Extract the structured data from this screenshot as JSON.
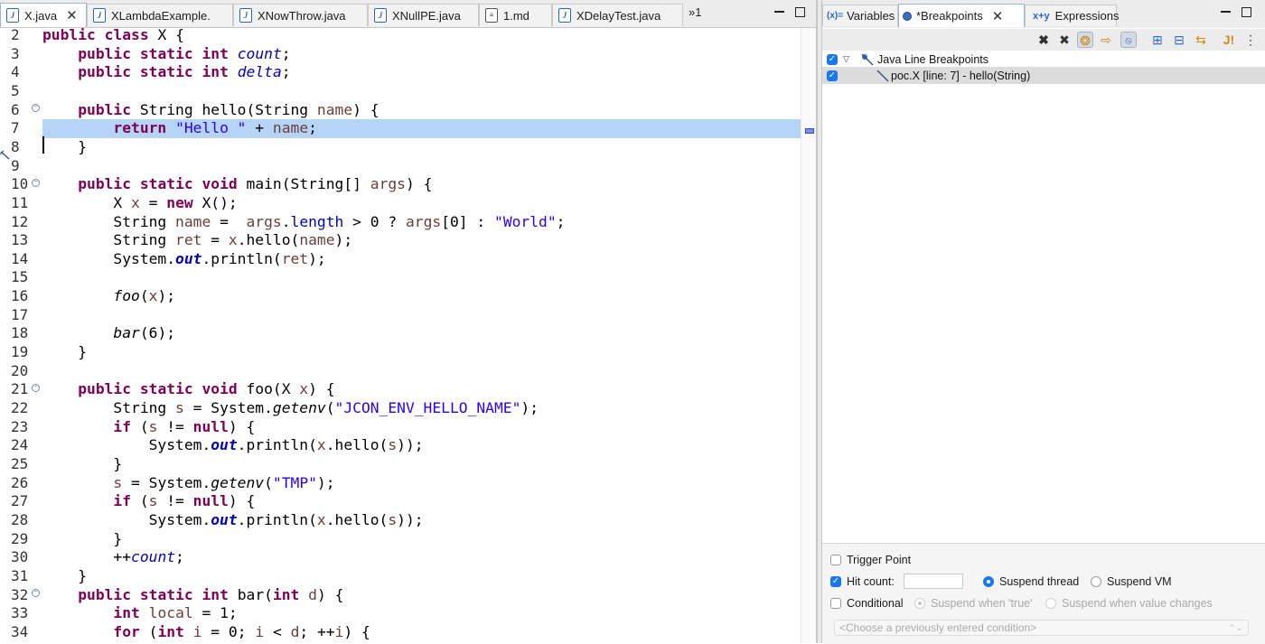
{
  "editor": {
    "tabs": [
      {
        "label": "X.java",
        "icon": "java-file-icon",
        "active": true,
        "closable": true
      },
      {
        "label": "XLambdaExample.",
        "icon": "java-file-icon"
      },
      {
        "label": "XNowThrow.java",
        "icon": "java-file-icon"
      },
      {
        "label": "XNullPE.java",
        "icon": "java-file-icon"
      },
      {
        "label": "1.md",
        "icon": "markdown-file-icon"
      },
      {
        "label": "XDelayTest.java",
        "icon": "java-file-icon"
      }
    ],
    "overflow_label": "»1",
    "line_numbers": [
      "2",
      "3",
      "4",
      "5",
      "6",
      "7",
      "8",
      "9",
      "10",
      "11",
      "12",
      "13",
      "14",
      "15",
      "16",
      "17",
      "18",
      "19",
      "20",
      "21",
      "22",
      "23",
      "24",
      "25",
      "26",
      "27",
      "28",
      "29",
      "30",
      "31",
      "32",
      "33",
      "34"
    ],
    "highlighted_line": "7",
    "code_lines": [
      [
        [
          "kw",
          "public"
        ],
        [
          "t",
          " "
        ],
        [
          "kw",
          "class"
        ],
        [
          "t",
          " X {"
        ]
      ],
      [
        [
          "t",
          "    "
        ],
        [
          "kw",
          "public"
        ],
        [
          "t",
          " "
        ],
        [
          "kw",
          "static"
        ],
        [
          "t",
          " "
        ],
        [
          "kw",
          "int"
        ],
        [
          "t",
          " "
        ],
        [
          "fld",
          "count"
        ],
        [
          "t",
          ";"
        ]
      ],
      [
        [
          "t",
          "    "
        ],
        [
          "kw",
          "public"
        ],
        [
          "t",
          " "
        ],
        [
          "kw",
          "static"
        ],
        [
          "t",
          " "
        ],
        [
          "kw",
          "int"
        ],
        [
          "t",
          " "
        ],
        [
          "fld",
          "delta"
        ],
        [
          "t",
          ";"
        ]
      ],
      [
        [
          "t",
          ""
        ]
      ],
      [
        [
          "t",
          "    "
        ],
        [
          "kw",
          "public"
        ],
        [
          "t",
          " String hello(String "
        ],
        [
          "var",
          "name"
        ],
        [
          "t",
          ") {"
        ]
      ],
      [
        [
          "t",
          "        "
        ],
        [
          "kw",
          "return"
        ],
        [
          "t",
          " "
        ],
        [
          "str",
          "\"Hello \""
        ],
        [
          "t",
          " + "
        ],
        [
          "var",
          "name"
        ],
        [
          "t",
          ";"
        ]
      ],
      [
        [
          "t",
          "    }"
        ]
      ],
      [
        [
          "t",
          ""
        ]
      ],
      [
        [
          "t",
          "    "
        ],
        [
          "kw",
          "public"
        ],
        [
          "t",
          " "
        ],
        [
          "kw",
          "static"
        ],
        [
          "t",
          " "
        ],
        [
          "kw",
          "void"
        ],
        [
          "t",
          " main(String[] "
        ],
        [
          "var",
          "args"
        ],
        [
          "t",
          ") {"
        ]
      ],
      [
        [
          "t",
          "        X "
        ],
        [
          "var",
          "x"
        ],
        [
          "t",
          " = "
        ],
        [
          "kw",
          "new"
        ],
        [
          "t",
          " X();"
        ]
      ],
      [
        [
          "t",
          "        String "
        ],
        [
          "var",
          "name"
        ],
        [
          "t",
          " =  "
        ],
        [
          "var",
          "args"
        ],
        [
          "t",
          "."
        ],
        [
          "mfld",
          "length"
        ],
        [
          "t",
          " > 0 ? "
        ],
        [
          "var",
          "args"
        ],
        [
          "t",
          "[0] : "
        ],
        [
          "str",
          "\"World\""
        ],
        [
          "t",
          ";"
        ]
      ],
      [
        [
          "t",
          "        String "
        ],
        [
          "var",
          "ret"
        ],
        [
          "t",
          " = "
        ],
        [
          "var",
          "x"
        ],
        [
          "t",
          ".hello("
        ],
        [
          "var",
          "name"
        ],
        [
          "t",
          ");"
        ]
      ],
      [
        [
          "t",
          "        System."
        ],
        [
          "sfld",
          "out"
        ],
        [
          "t",
          ".println("
        ],
        [
          "var",
          "ret"
        ],
        [
          "t",
          ");"
        ]
      ],
      [
        [
          "t",
          ""
        ]
      ],
      [
        [
          "t",
          "        "
        ],
        [
          "ital",
          "foo"
        ],
        [
          "t",
          "("
        ],
        [
          "var",
          "x"
        ],
        [
          "t",
          ");"
        ]
      ],
      [
        [
          "t",
          ""
        ]
      ],
      [
        [
          "t",
          "        "
        ],
        [
          "ital",
          "bar"
        ],
        [
          "t",
          "(6);"
        ]
      ],
      [
        [
          "t",
          "    }"
        ]
      ],
      [
        [
          "t",
          ""
        ]
      ],
      [
        [
          "t",
          "    "
        ],
        [
          "kw",
          "public"
        ],
        [
          "t",
          " "
        ],
        [
          "kw",
          "static"
        ],
        [
          "t",
          " "
        ],
        [
          "kw",
          "void"
        ],
        [
          "t",
          " foo(X "
        ],
        [
          "var",
          "x"
        ],
        [
          "t",
          ") {"
        ]
      ],
      [
        [
          "t",
          "        String "
        ],
        [
          "var",
          "s"
        ],
        [
          "t",
          " = System."
        ],
        [
          "ital",
          "getenv"
        ],
        [
          "t",
          "("
        ],
        [
          "str",
          "\"JCON_ENV_HELLO_NAME\""
        ],
        [
          "t",
          ");"
        ]
      ],
      [
        [
          "t",
          "        "
        ],
        [
          "kw",
          "if"
        ],
        [
          "t",
          " ("
        ],
        [
          "var",
          "s"
        ],
        [
          "t",
          " != "
        ],
        [
          "kw",
          "null"
        ],
        [
          "t",
          ") {"
        ]
      ],
      [
        [
          "t",
          "            System."
        ],
        [
          "sfld",
          "out"
        ],
        [
          "t",
          ".println("
        ],
        [
          "var",
          "x"
        ],
        [
          "t",
          ".hello("
        ],
        [
          "var",
          "s"
        ],
        [
          "t",
          "));"
        ]
      ],
      [
        [
          "t",
          "        }"
        ]
      ],
      [
        [
          "t",
          "        "
        ],
        [
          "var",
          "s"
        ],
        [
          "t",
          " = System."
        ],
        [
          "ital",
          "getenv"
        ],
        [
          "t",
          "("
        ],
        [
          "str",
          "\"TMP\""
        ],
        [
          "t",
          ");"
        ]
      ],
      [
        [
          "t",
          "        "
        ],
        [
          "kw",
          "if"
        ],
        [
          "t",
          " ("
        ],
        [
          "var",
          "s"
        ],
        [
          "t",
          " != "
        ],
        [
          "kw",
          "null"
        ],
        [
          "t",
          ") {"
        ]
      ],
      [
        [
          "t",
          "            System."
        ],
        [
          "sfld",
          "out"
        ],
        [
          "t",
          ".println("
        ],
        [
          "var",
          "x"
        ],
        [
          "t",
          ".hello("
        ],
        [
          "var",
          "s"
        ],
        [
          "t",
          "));"
        ]
      ],
      [
        [
          "t",
          "        }"
        ]
      ],
      [
        [
          "t",
          "        ++"
        ],
        [
          "fld",
          "count"
        ],
        [
          "t",
          ";"
        ]
      ],
      [
        [
          "t",
          "    }"
        ]
      ],
      [
        [
          "t",
          "    "
        ],
        [
          "kw",
          "public"
        ],
        [
          "t",
          " "
        ],
        [
          "kw",
          "static"
        ],
        [
          "t",
          " "
        ],
        [
          "kw",
          "int"
        ],
        [
          "t",
          " bar("
        ],
        [
          "kw",
          "int"
        ],
        [
          "t",
          " "
        ],
        [
          "var",
          "d"
        ],
        [
          "t",
          ") {"
        ]
      ],
      [
        [
          "t",
          "        "
        ],
        [
          "kw",
          "int"
        ],
        [
          "t",
          " "
        ],
        [
          "var",
          "local"
        ],
        [
          "t",
          " = 1;"
        ]
      ],
      [
        [
          "t",
          "        "
        ],
        [
          "kw",
          "for"
        ],
        [
          "t",
          " ("
        ],
        [
          "kw",
          "int"
        ],
        [
          "t",
          " "
        ],
        [
          "var",
          "i"
        ],
        [
          "t",
          " = 0; "
        ],
        [
          "var",
          "i"
        ],
        [
          "t",
          " < "
        ],
        [
          "var",
          "d"
        ],
        [
          "t",
          "; ++"
        ],
        [
          "var",
          "i"
        ],
        [
          "t",
          ") {"
        ]
      ]
    ]
  },
  "right_panel": {
    "tabs": [
      {
        "label": "Variables",
        "icon": "variables-icon"
      },
      {
        "label": "*Breakpoints",
        "icon": "breakpoints-icon",
        "active": true,
        "closable": true
      },
      {
        "label": "Expressions",
        "icon": "expressions-icon"
      }
    ],
    "toolbar_icons": [
      "remove-breakpoint-icon",
      "remove-all-breakpoints-icon",
      "show-supported-breakpoints-icon",
      "go-to-file-icon",
      "skip-all-breakpoints-icon",
      "expand-all-icon",
      "collapse-all-icon",
      "link-with-debug-view-icon",
      "add-java-exception-breakpoint-icon",
      "view-menu-icon"
    ],
    "tree": [
      {
        "label": "Java Line Breakpoints",
        "checked": true,
        "expanded": true,
        "level": 0
      },
      {
        "label": "poc.X [line: 7] - hello(String)",
        "checked": true,
        "level": 1,
        "selected": true
      }
    ],
    "details": {
      "trigger_point_label": "Trigger Point",
      "trigger_point_checked": false,
      "hit_count_label": "Hit count:",
      "hit_count_checked": true,
      "hit_count_value": "",
      "suspend_thread_label": "Suspend thread",
      "suspend_vm_label": "Suspend VM",
      "suspend_choice": "thread",
      "conditional_label": "Conditional",
      "conditional_checked": false,
      "suspend_true_label": "Suspend when 'true'",
      "suspend_changes_label": "Suspend when value changes",
      "condition_placeholder": "<Choose a previously entered condition>"
    }
  },
  "colors": {
    "keyword": "#7f0055",
    "field": "#0000c0",
    "string": "#2a00ff",
    "local_variable": "#6a3e3e",
    "current_line": "#b5d4f6",
    "checkbox_accent": "#1877f2"
  }
}
